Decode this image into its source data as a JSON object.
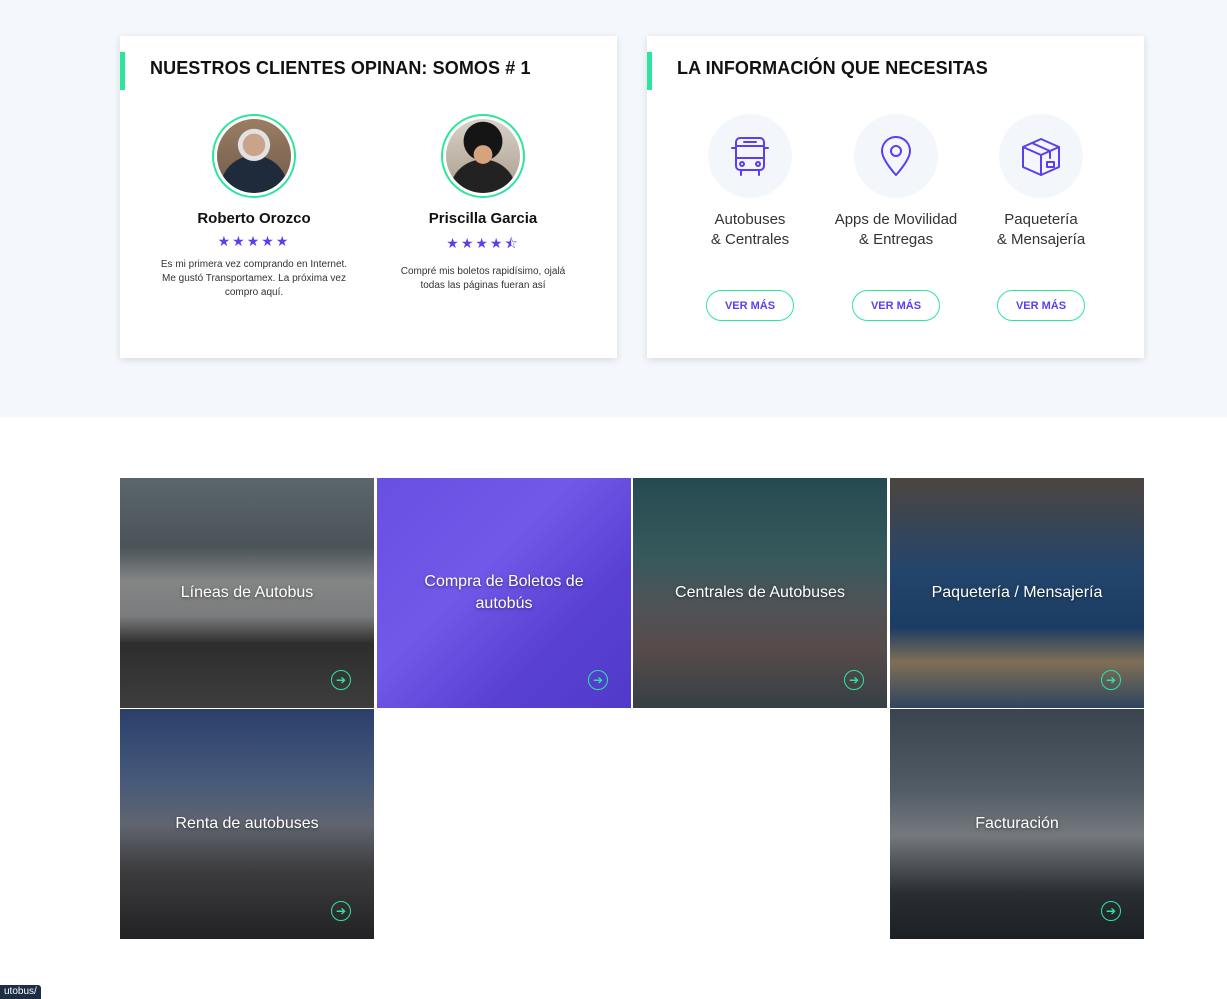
{
  "testimonials": {
    "title": "NUESTROS CLIENTES OPINAN: SOMOS # 1",
    "reviews": [
      {
        "name": "Roberto Orozco",
        "stars": "★★★★★",
        "rating": 5,
        "text": "Es mi primera vez comprando en Internet. Me gustó Transportamex. La próxima vez compro aquí."
      },
      {
        "name": "Priscilla Garcia",
        "stars": "★★★★⯪",
        "rating": 4.5,
        "text": "Compré mis boletos rapidísimo, ojalá todas las páginas fueran así"
      }
    ]
  },
  "info": {
    "title": "LA INFORMACIÓN QUE NECESITAS",
    "items": [
      {
        "icon": "bus-icon",
        "line1": "Autobuses",
        "line2": "& Centrales",
        "button": "VER MÁS"
      },
      {
        "icon": "map-pin-icon",
        "line1": "Apps de Movilidad",
        "line2": "& Entregas",
        "button": "VER MÁS"
      },
      {
        "icon": "package-icon",
        "line1": "Paquetería",
        "line2": "& Mensajería",
        "button": "VER MÁS"
      }
    ]
  },
  "tiles": [
    {
      "label": "Líneas de Autobus"
    },
    {
      "label": "Compra de Boletos de autobús"
    },
    {
      "label": "Centrales de Autobuses"
    },
    {
      "label": "Paquetería / Mensajería"
    },
    {
      "label": "Renta de autobuses"
    },
    {
      "label": "Facturación"
    }
  ],
  "status_url": "utobus/",
  "colors": {
    "accent_green": "#2ee59d",
    "brand_purple": "#5b3ef0",
    "top_band": "#f4f8fc"
  }
}
